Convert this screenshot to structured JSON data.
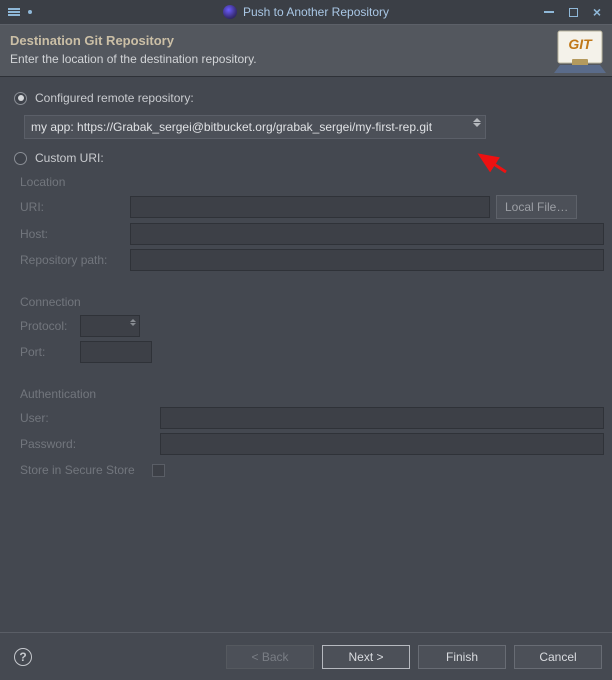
{
  "titlebar": {
    "title": "Push to Another Repository"
  },
  "header": {
    "title": "Destination Git Repository",
    "subtitle": "Enter the location of the destination repository."
  },
  "options": {
    "configured_label": "Configured remote repository:",
    "custom_label": "Custom URI:",
    "selected_remote": "my app: https://Grabak_sergei@bitbucket.org/grabak_sergei/my-first-rep.git"
  },
  "location": {
    "group": "Location",
    "uri_label": "URI:",
    "uri_value": "",
    "local_file_btn": "Local File…",
    "host_label": "Host:",
    "host_value": "",
    "repo_label": "Repository path:",
    "repo_value": ""
  },
  "connection": {
    "group": "Connection",
    "protocol_label": "Protocol:",
    "protocol_value": "",
    "port_label": "Port:",
    "port_value": ""
  },
  "auth": {
    "group": "Authentication",
    "user_label": "User:",
    "user_value": "",
    "password_label": "Password:",
    "password_value": "",
    "store_label": "Store in Secure Store"
  },
  "footer": {
    "back": "< Back",
    "next": "Next >",
    "finish": "Finish",
    "cancel": "Cancel"
  }
}
